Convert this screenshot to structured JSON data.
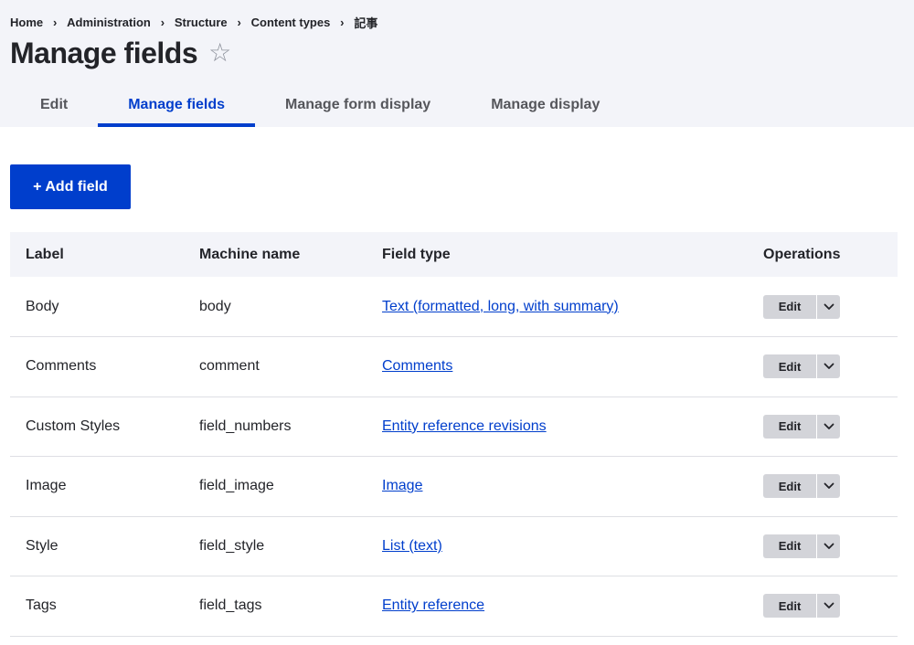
{
  "breadcrumb": [
    {
      "label": "Home"
    },
    {
      "label": "Administration"
    },
    {
      "label": "Structure"
    },
    {
      "label": "Content types"
    },
    {
      "label": "記事"
    }
  ],
  "breadcrumb_separator": "›",
  "page": {
    "title": "Manage fields",
    "favorite_icon": "☆"
  },
  "tabs": [
    {
      "label": "Edit",
      "active": false
    },
    {
      "label": "Manage fields",
      "active": true
    },
    {
      "label": "Manage form display",
      "active": false
    },
    {
      "label": "Manage display",
      "active": false
    }
  ],
  "actions": {
    "add_field_label": "+ Add field"
  },
  "table": {
    "headers": {
      "label": "Label",
      "machine_name": "Machine name",
      "field_type": "Field type",
      "operations": "Operations"
    },
    "rows": [
      {
        "label": "Body",
        "machine_name": "body",
        "field_type": "Text (formatted, long, with summary)",
        "op": "Edit"
      },
      {
        "label": "Comments",
        "machine_name": "comment",
        "field_type": "Comments",
        "op": "Edit"
      },
      {
        "label": "Custom Styles",
        "machine_name": "field_numbers",
        "field_type": "Entity reference revisions",
        "op": "Edit"
      },
      {
        "label": "Image",
        "machine_name": "field_image",
        "field_type": "Image",
        "op": "Edit"
      },
      {
        "label": "Style",
        "machine_name": "field_style",
        "field_type": "List (text)",
        "op": "Edit"
      },
      {
        "label": "Tags",
        "machine_name": "field_tags",
        "field_type": "Entity reference",
        "op": "Edit"
      }
    ]
  },
  "colors": {
    "accent": "#003ecc",
    "header_bg": "#f3f4f9",
    "text": "#232429",
    "button_grey": "#d3d4d9"
  }
}
